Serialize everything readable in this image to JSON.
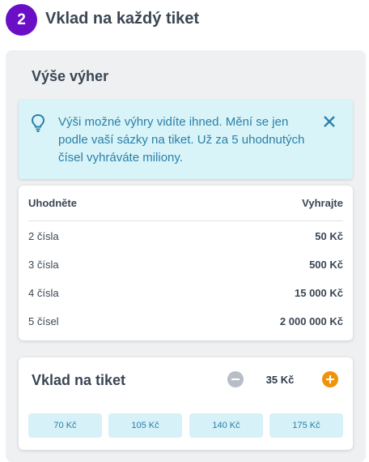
{
  "step": {
    "number": "2",
    "title": "Vklad na každý tiket"
  },
  "panel": {
    "title": "Výše výher"
  },
  "info": {
    "text": "Výši možné výhry vidíte ihned. Mění se jen podle vaší sázky na tiket. Už za 5 uhodnutých čísel vyhráváte miliony.",
    "icon": "lightbulb-icon",
    "close_icon": "close-icon"
  },
  "table": {
    "headers": {
      "guess": "Uhodněte",
      "win": "Vyhrajte"
    },
    "rows": [
      {
        "guess": "2 čísla",
        "win": "50 Kč"
      },
      {
        "guess": "3 čísla",
        "win": "500 Kč"
      },
      {
        "guess": "4 čísla",
        "win": "15 000 Kč"
      },
      {
        "guess": "5 čísel",
        "win": "2 000 000 Kč"
      }
    ]
  },
  "stake": {
    "title": "Vklad na tiket",
    "value": "35 Kč",
    "presets": [
      "70 Kč",
      "105 Kč",
      "140 Kč",
      "175 Kč"
    ]
  },
  "colors": {
    "accent_purple": "#6a0fc6",
    "info_bg": "#d8f4f8",
    "info_text": "#2b7fa8",
    "plus_orange": "#f0930a",
    "minus_grey": "#b7bec6"
  }
}
